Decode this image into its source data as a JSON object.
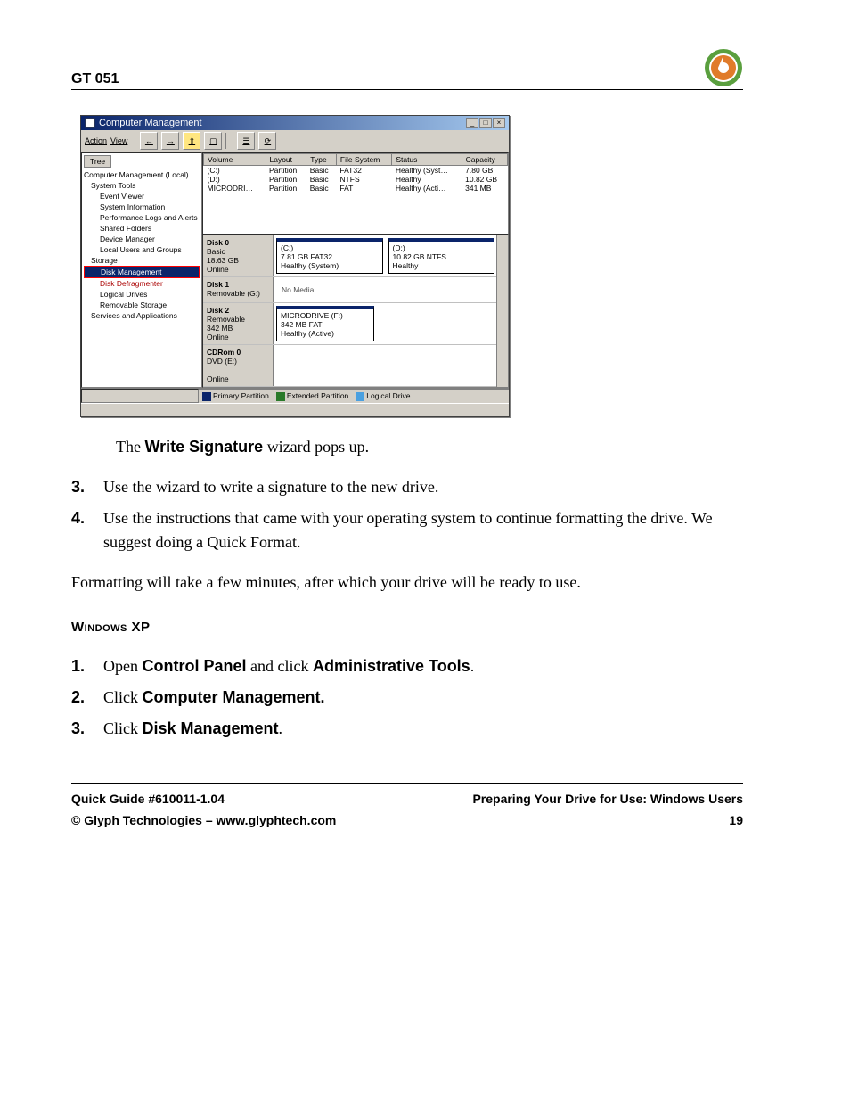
{
  "header": {
    "title": "GT 051"
  },
  "screenshot": {
    "window_title": "Computer Management",
    "menu": {
      "action": "Action",
      "view": "View"
    },
    "tree_header": "Tree",
    "tree": {
      "root": "Computer Management (Local)",
      "system_tools": "System Tools",
      "event_viewer": "Event Viewer",
      "system_information": "System Information",
      "perf_logs": "Performance Logs and Alerts",
      "shared_folders": "Shared Folders",
      "device_manager": "Device Manager",
      "local_users": "Local Users and Groups",
      "storage": "Storage",
      "disk_management": "Disk Management",
      "disk_defrag": "Disk Defragmenter",
      "logical_drives": "Logical Drives",
      "removable_storage": "Removable Storage",
      "services": "Services and Applications"
    },
    "columns": {
      "volume": "Volume",
      "layout": "Layout",
      "type": "Type",
      "file_system": "File System",
      "status": "Status",
      "capacity": "Capacity"
    },
    "rows": [
      {
        "volume": "(C:)",
        "layout": "Partition",
        "type": "Basic",
        "fs": "FAT32",
        "status": "Healthy (Syst…",
        "capacity": "7.80 GB"
      },
      {
        "volume": "(D:)",
        "layout": "Partition",
        "type": "Basic",
        "fs": "NTFS",
        "status": "Healthy",
        "capacity": "10.82 GB"
      },
      {
        "volume": "MICRODRI…",
        "layout": "Partition",
        "type": "Basic",
        "fs": "FAT",
        "status": "Healthy (Acti…",
        "capacity": "341 MB"
      }
    ],
    "disks": {
      "disk0": {
        "name": "Disk 0",
        "sub1": "Basic",
        "sub2": "18.63 GB",
        "sub3": "Online",
        "p1_a": "(C:)",
        "p1_b": "7.81 GB FAT32",
        "p1_c": "Healthy (System)",
        "p2_a": "(D:)",
        "p2_b": "10.82 GB NTFS",
        "p2_c": "Healthy"
      },
      "disk1": {
        "name": "Disk 1",
        "sub1": "Removable (G:)",
        "none": "No Media"
      },
      "disk2": {
        "name": "Disk 2",
        "sub1": "Removable",
        "sub2": "342 MB",
        "sub3": "Online",
        "p1_a": "MICRODRIVE (F:)",
        "p1_b": "342 MB FAT",
        "p1_c": "Healthy (Active)"
      },
      "cdrom": {
        "name": "CDRom 0",
        "sub1": "DVD (E:)",
        "sub3": "Online"
      }
    },
    "legend": {
      "primary": "Primary Partition",
      "extended": "Extended Partition",
      "logical": "Logical Drive"
    }
  },
  "text": {
    "wizard_line_pre": "The ",
    "wizard_bold": "Write Signature",
    "wizard_line_post": " wizard pops up.",
    "step3_num": "3.",
    "step3": "Use the wizard to write a signature to the new drive.",
    "step4_num": "4.",
    "step4": "Use the instructions that came with your operating system to continue formatting the drive. We suggest doing a Quick Format.",
    "formatting": "Formatting will take a few minutes, after which your drive will be ready to use.",
    "xp_head": "Windows XP",
    "xp1_num": "1.",
    "xp1_a": "Open ",
    "xp1_b": "Control Panel",
    "xp1_c": " and click ",
    "xp1_d": "Administrative Tools",
    "xp1_e": ".",
    "xp2_num": "2.",
    "xp2_a": "Click ",
    "xp2_b": "Computer Management.",
    "xp3_num": "3.",
    "xp3_a": "Click ",
    "xp3_b": "Disk Management",
    "xp3_c": "."
  },
  "footer": {
    "left1": "Quick Guide  #610011-1.04",
    "right1": "Preparing Your Drive for Use: Windows Users",
    "left2": "© Glyph Technologies – www.glyphtech.com",
    "right2": "19"
  }
}
